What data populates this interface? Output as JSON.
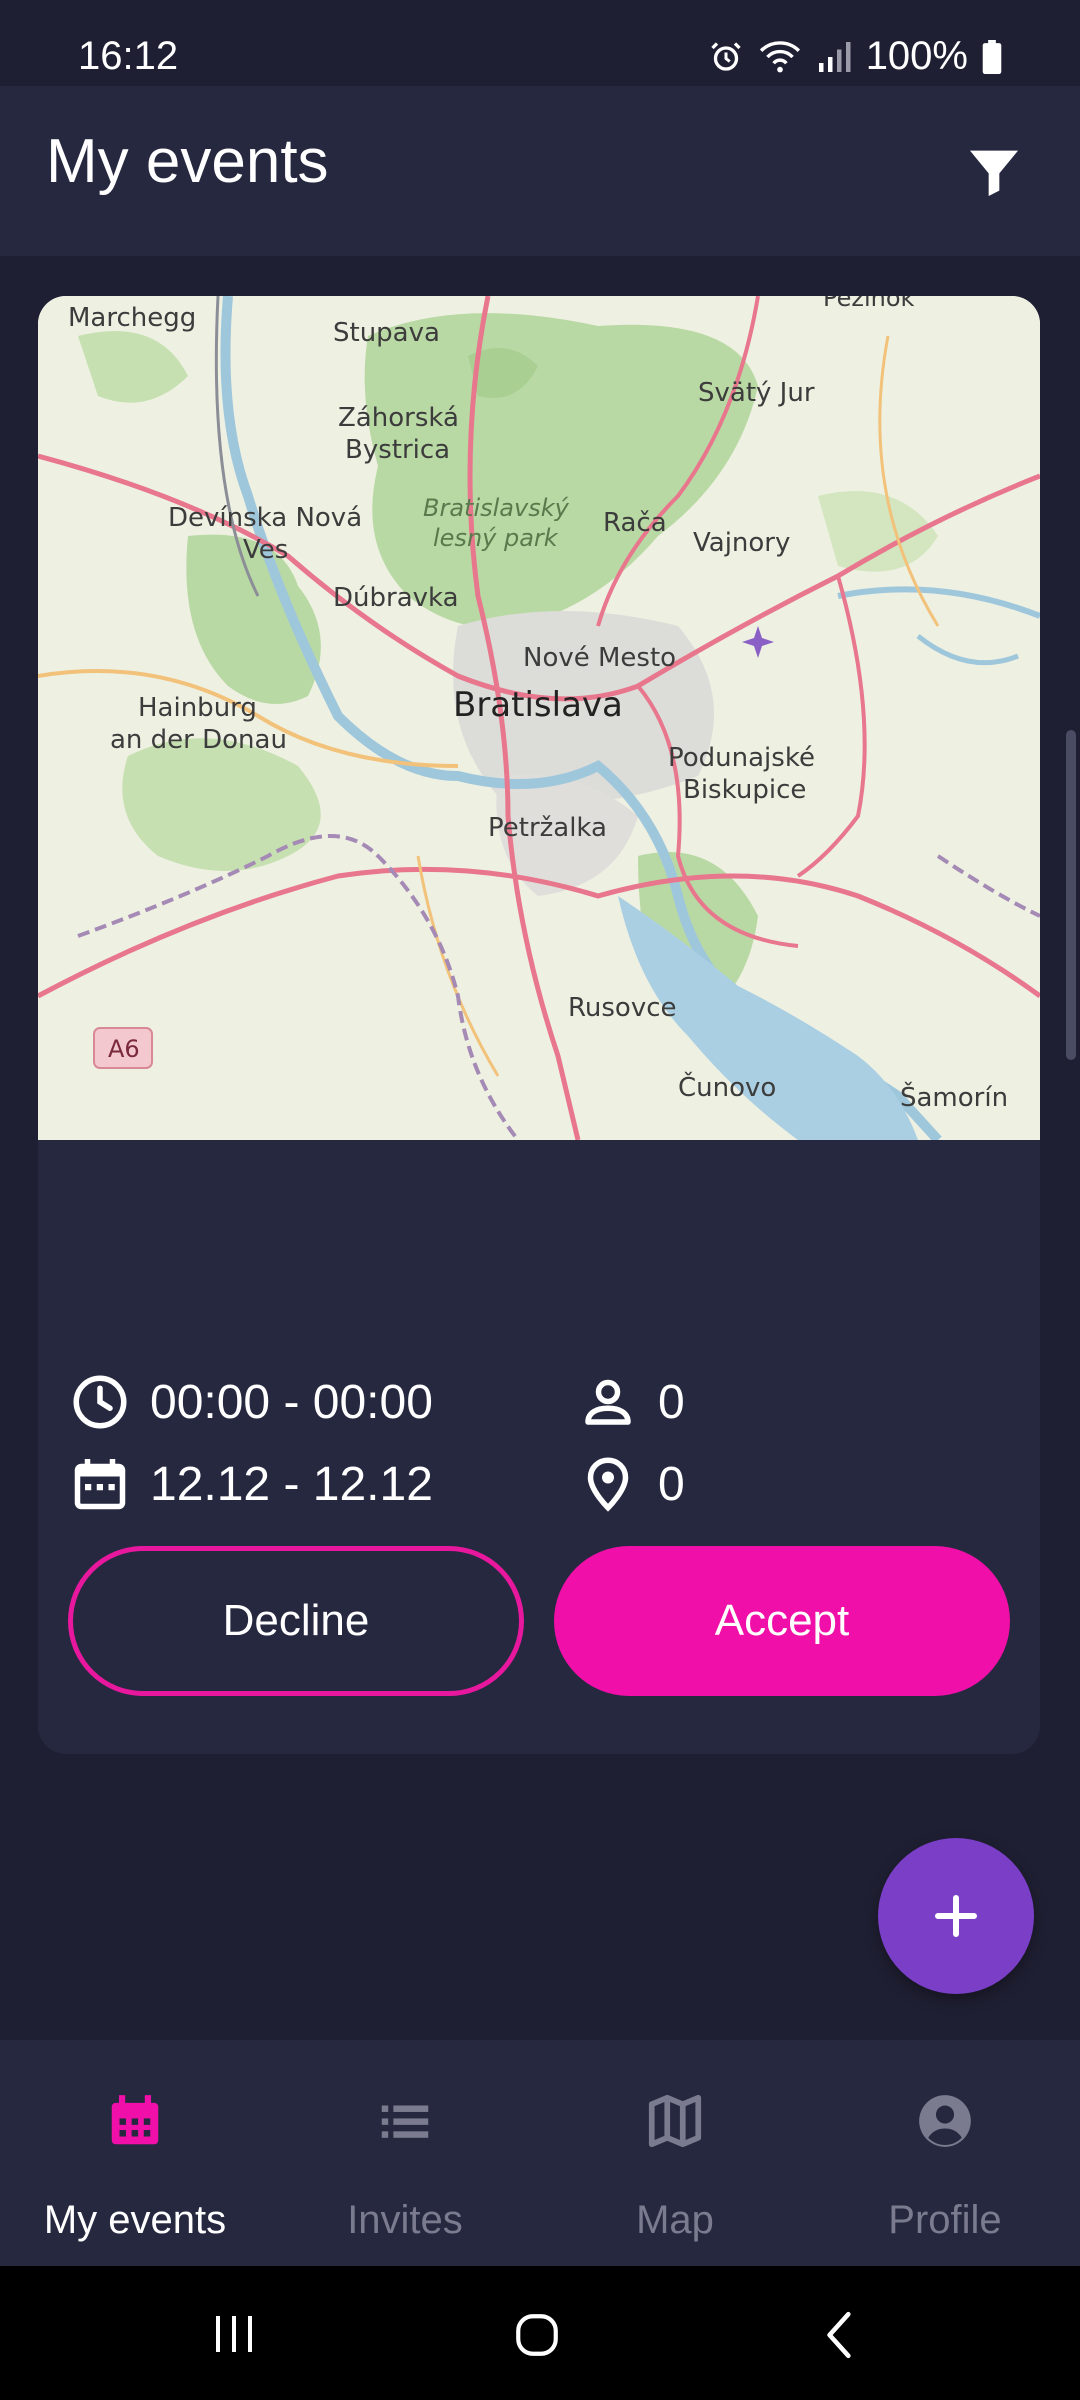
{
  "status_bar": {
    "time": "16:12",
    "battery": "100%"
  },
  "app_bar": {
    "title": "My events",
    "filter_icon": "filter-icon"
  },
  "map": {
    "labels": {
      "marchegg": "Marchegg",
      "stupava": "Stupava",
      "pezinok": "Pezinok",
      "zahorska1": "Záhorská",
      "zahorska2": "Bystrica",
      "svaty_jur": "Svätý Jur",
      "devinska1": "Devínska Nová",
      "devinska2": "Ves",
      "park1": "Bratislavský",
      "park2": "lesný park",
      "raca": "Rača",
      "vajnory": "Vajnory",
      "dubravka": "Dúbravka",
      "nove_mesto": "Nové Mesto",
      "bratislava": "Bratislava",
      "hainburg1": "Hainburg",
      "hainburg2": "an der Donau",
      "podunajske1": "Podunajské",
      "podunajske2": "Biskupice",
      "petrzalka": "Petržalka",
      "rusovce": "Rusovce",
      "cunovo": "Čunovo",
      "samorin": "Šamorín",
      "a6": "A6"
    }
  },
  "event": {
    "time_range": "00:00 - 00:00",
    "date_range": "12.12 - 12.12",
    "participants": "0",
    "locations": "0"
  },
  "buttons": {
    "decline": "Decline",
    "accept": "Accept"
  },
  "nav": {
    "items": [
      {
        "label": "My events",
        "icon": "calendar-icon"
      },
      {
        "label": "Invites",
        "icon": "list-icon"
      },
      {
        "label": "Map",
        "icon": "map-icon"
      },
      {
        "label": "Profile",
        "icon": "account-circle-icon"
      }
    ]
  },
  "colors": {
    "accent": "#f00fa8",
    "fab": "#7b3fc7",
    "background": "#1f1f33",
    "surface": "#262840"
  }
}
